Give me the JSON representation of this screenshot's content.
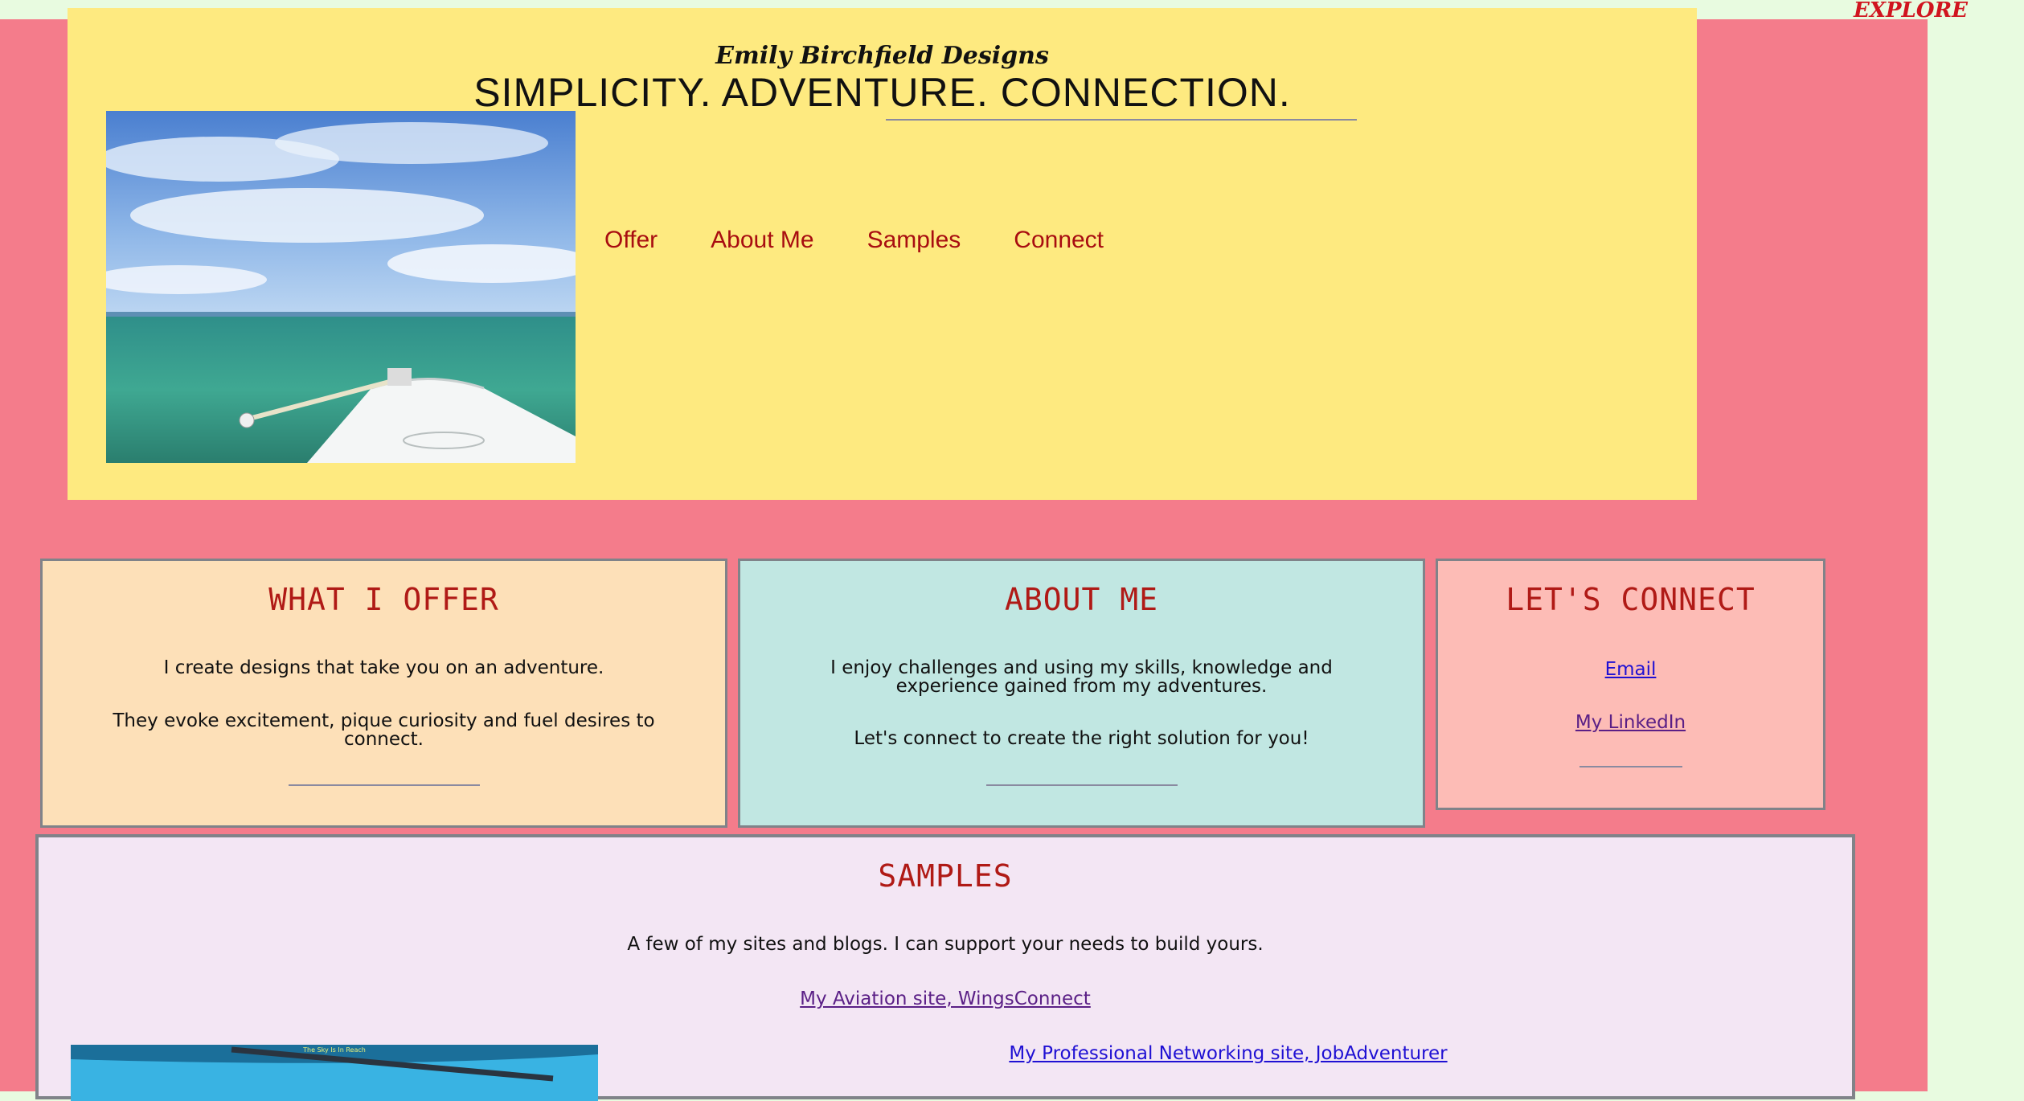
{
  "topbar": {
    "explore_label": "EXPLORE"
  },
  "header": {
    "brand": "Emily Birchfield Designs",
    "tagline": "SIMPLICITY. ADVENTURE. CONNECTION.",
    "nav": [
      "Offer",
      "About Me",
      "Samples",
      "Connect"
    ]
  },
  "offer": {
    "title": "WHAT I OFFER",
    "p1": "I create designs that take you on an adventure.",
    "p2": "They evoke excitement, pique curiosity and fuel desires to connect."
  },
  "about": {
    "title": "ABOUT ME",
    "p1": "I enjoy challenges and using my skills, knowledge and experience gained from my adventures.",
    "p2": "Let's connect to create the right solution for you!"
  },
  "connect": {
    "title": "LET'S CONNECT",
    "email": "Email",
    "linkedin": "My LinkedIn"
  },
  "samples": {
    "title": "SAMPLES",
    "intro": "A few of my sites and blogs. I can support your needs to build yours.",
    "link1": "My Aviation site, WingsConnect",
    "link2": "My Professional Networking site, JobAdventurer",
    "thumb_caption": "The Sky Is In Reach"
  },
  "colors": {
    "page_bg": "#f47c8b",
    "header_bg": "#feea80",
    "offer_bg": "#fde0b8",
    "about_bg": "#c1e7e2",
    "connect_bg": "#fdbcb6",
    "samples_bg": "#f3e6f4",
    "heading": "#b01a16",
    "nav": "#a80d10"
  }
}
